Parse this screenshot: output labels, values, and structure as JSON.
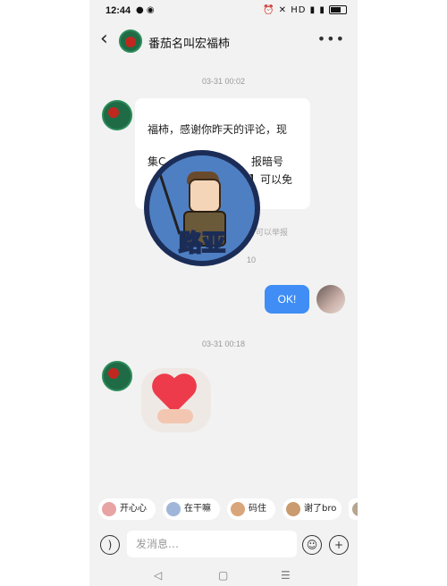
{
  "status_bar": {
    "time": "12:44",
    "battery_level": 0.6
  },
  "header": {
    "back_icon": "chevron-left-icon",
    "contact_name": "番茄名叫宏福柿",
    "more_icon": "ellipsis-icon"
  },
  "messages": {
    "timestamp_1": "03-31 00:02",
    "incoming_text_lines": [
      "福柿，感谢你昨天的评论，现",
      "集C",
      "报暗号",
      "】可以免"
    ],
    "report_hint": "可以举报",
    "timestamp_partial": "10",
    "outgoing_text": "OK!",
    "timestamp_2": "03-31 00:18"
  },
  "overlay_logo": {
    "text": "路亚"
  },
  "quick_replies": [
    {
      "label": "开心心"
    },
    {
      "label": "在干嘛"
    },
    {
      "label": "码住"
    },
    {
      "label": "谢了bro"
    }
  ],
  "input_bar": {
    "placeholder": "发消息…"
  },
  "colors": {
    "accent_blue": "#3f8df5",
    "background": "#f2f2f2"
  }
}
